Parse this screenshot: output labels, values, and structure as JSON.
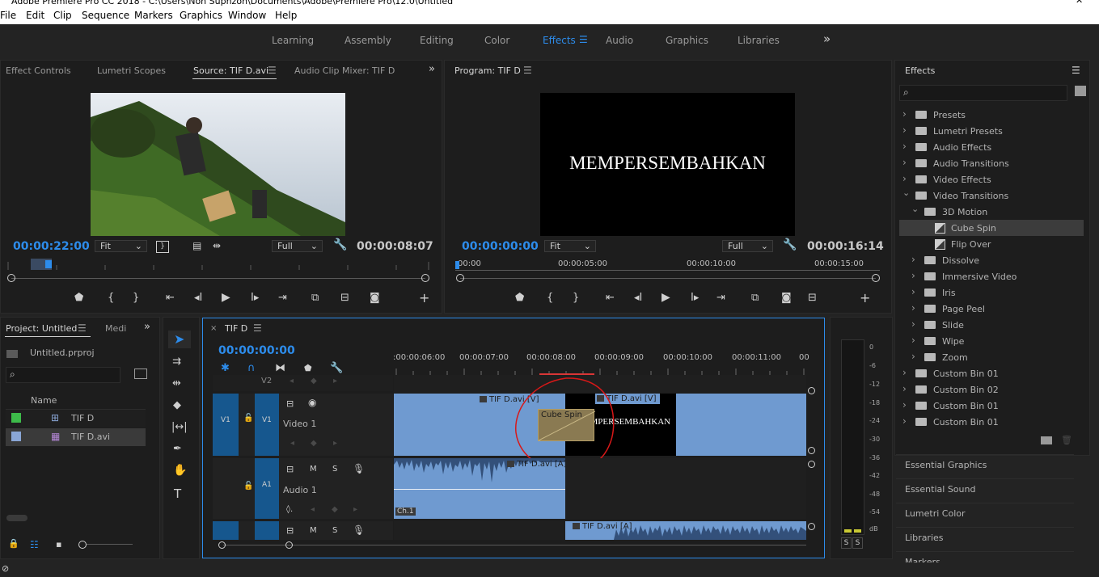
{
  "window": {
    "title": "Adobe Premiere Pro CC 2018 - C:\\Users\\Non Suphzon\\Documents\\Adobe\\Premiere Pro\\12.0\\Untitled"
  },
  "menu": [
    "File",
    "Edit",
    "Clip",
    "Sequence",
    "Markers",
    "Graphics",
    "Window",
    "Help"
  ],
  "workspaces": [
    "Learning",
    "Assembly",
    "Editing",
    "Color",
    "Effects",
    "Audio",
    "Graphics",
    "Libraries"
  ],
  "workspace_active": "Effects",
  "overflow_glyph": "»",
  "source_panel": {
    "tabs": [
      "Effect Controls",
      "Lumetri Scopes",
      "Source: TIF D.avi",
      "Audio Clip Mixer: TIF D"
    ],
    "timecode": "00:00:22:00",
    "fit": "Fit",
    "quality": "Full",
    "duration": "00:00:08:07"
  },
  "program_panel": {
    "tab": "Program: TIF D",
    "timecode": "00:00:00:00",
    "fit": "Fit",
    "quality": "Full",
    "duration": "00:00:16:14",
    "frame_text": "MEMPERSEMBAHKAN",
    "ruler": [
      "00:00",
      "00:00:05:00",
      "00:00:10:00",
      "00:00:15:00"
    ]
  },
  "project_panel": {
    "tabs": [
      "Project: Untitled",
      "Medi"
    ],
    "file": "Untitled.prproj",
    "column": "Name",
    "items": [
      {
        "name": "TIF D",
        "color": "#3dbb4a"
      },
      {
        "name": "TIF D.avi",
        "color": "#8aa6d6"
      }
    ]
  },
  "timeline": {
    "tab": "TIF D",
    "timecode": "00:00:00:00",
    "ruler": [
      ":00:00:06:00",
      "00:00:07:00",
      "00:00:08:00",
      "00:00:09:00",
      "00:00:10:00",
      "00:00:11:00",
      "00"
    ],
    "tracks": {
      "v2": "V2",
      "v1": "V1",
      "v1_name": "Video 1",
      "a1": "A1",
      "a1_name": "Audio 1",
      "mute": "M",
      "solo": "S"
    },
    "clips": {
      "v1_left": "TIF D.avi [V]",
      "v1_right": "TIF D.avi [V]",
      "transition": "Cube Spin",
      "title_text": "MEMPERSEMBAHKAN",
      "a1_left": "TIF D.avi [A]",
      "a1_channel": "Ch.1",
      "a2_right": "TIF D.avi [A]"
    }
  },
  "meter": {
    "scale": [
      "0",
      "-6",
      "-12",
      "-18",
      "-24",
      "-30",
      "-36",
      "-42",
      "-48",
      "-54",
      "dB"
    ],
    "solo_buttons": [
      "S",
      "S"
    ]
  },
  "effects_panel": {
    "title": "Effects",
    "tree": [
      {
        "label": "Presets",
        "level": 0,
        "expanded": false,
        "kind": "star-folder"
      },
      {
        "label": "Lumetri Presets",
        "level": 0,
        "expanded": false,
        "kind": "star-folder"
      },
      {
        "label": "Audio Effects",
        "level": 0,
        "expanded": false,
        "kind": "folder"
      },
      {
        "label": "Audio Transitions",
        "level": 0,
        "expanded": false,
        "kind": "folder"
      },
      {
        "label": "Video Effects",
        "level": 0,
        "expanded": false,
        "kind": "folder"
      },
      {
        "label": "Video Transitions",
        "level": 0,
        "expanded": true,
        "kind": "folder"
      },
      {
        "label": "3D Motion",
        "level": 1,
        "expanded": true,
        "kind": "folder"
      },
      {
        "label": "Cube Spin",
        "level": 2,
        "expanded": false,
        "kind": "effect",
        "selected": true
      },
      {
        "label": "Flip Over",
        "level": 2,
        "expanded": false,
        "kind": "effect"
      },
      {
        "label": "Dissolve",
        "level": 1,
        "expanded": false,
        "kind": "folder"
      },
      {
        "label": "Immersive Video",
        "level": 1,
        "expanded": false,
        "kind": "folder"
      },
      {
        "label": "Iris",
        "level": 1,
        "expanded": false,
        "kind": "folder"
      },
      {
        "label": "Page Peel",
        "level": 1,
        "expanded": false,
        "kind": "folder"
      },
      {
        "label": "Slide",
        "level": 1,
        "expanded": false,
        "kind": "folder"
      },
      {
        "label": "Wipe",
        "level": 1,
        "expanded": false,
        "kind": "folder"
      },
      {
        "label": "Zoom",
        "level": 1,
        "expanded": false,
        "kind": "folder"
      },
      {
        "label": "Custom Bin 01",
        "level": 0,
        "expanded": false,
        "kind": "folder"
      },
      {
        "label": "Custom Bin 02",
        "level": 0,
        "expanded": false,
        "kind": "folder"
      },
      {
        "label": "Custom Bin 01",
        "level": 0,
        "expanded": false,
        "kind": "folder"
      },
      {
        "label": "Custom Bin 01",
        "level": 0,
        "expanded": false,
        "kind": "folder"
      }
    ],
    "side_panels": [
      "Essential Graphics",
      "Essential Sound",
      "Lumetri Color",
      "Libraries",
      "Markers"
    ]
  }
}
